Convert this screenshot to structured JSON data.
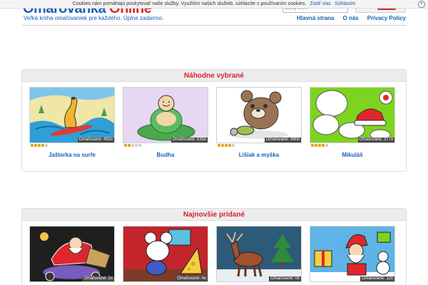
{
  "cookie": {
    "text": "Cookies nám pomáhajú poskytovať naše služby. Využitím našich služieb, súhlasíte s používaním cookies.",
    "more_label": "Zistiť viac",
    "agree_label": "Súhlasím"
  },
  "header": {
    "logo_main": "Omaľovánka ",
    "logo_accent": "Online",
    "tagline": "Veľká kniha omaľovaniek pre každého. Úplne zadarmo.",
    "search_placeholder": "Zadaj slovo",
    "nav": [
      "Hlavná strana",
      "O nás",
      "Privacy Policy"
    ]
  },
  "random_section": {
    "title": "Náhodne vybrané",
    "cards": [
      {
        "title": "Jašterka na surfe",
        "badge": "Omaľované: 492x",
        "stars": 4
      },
      {
        "title": "Budha",
        "badge": "Omaľované: 535x",
        "stars": 2
      },
      {
        "title": "Líšiak a myška",
        "badge": "Omaľované: 490x",
        "stars": 4
      },
      {
        "title": "Mikuláš",
        "badge": "Omaľované: 377x",
        "stars": 4
      }
    ]
  },
  "newest_section": {
    "title": "Najnovšie pridané",
    "cards": [
      {
        "badge": "Omaľované: 2x",
        "stars": 0
      },
      {
        "badge": "Omaľované: 4x",
        "stars": 0
      },
      {
        "badge": "Omaľované: 0x",
        "stars": 0
      },
      {
        "badge": "Omaľované: 12x",
        "stars": 0
      }
    ]
  },
  "colors": {
    "brand_blue": "#1a5fb4",
    "accent_red": "#d8232a",
    "star_gold": "#e0a81c"
  }
}
